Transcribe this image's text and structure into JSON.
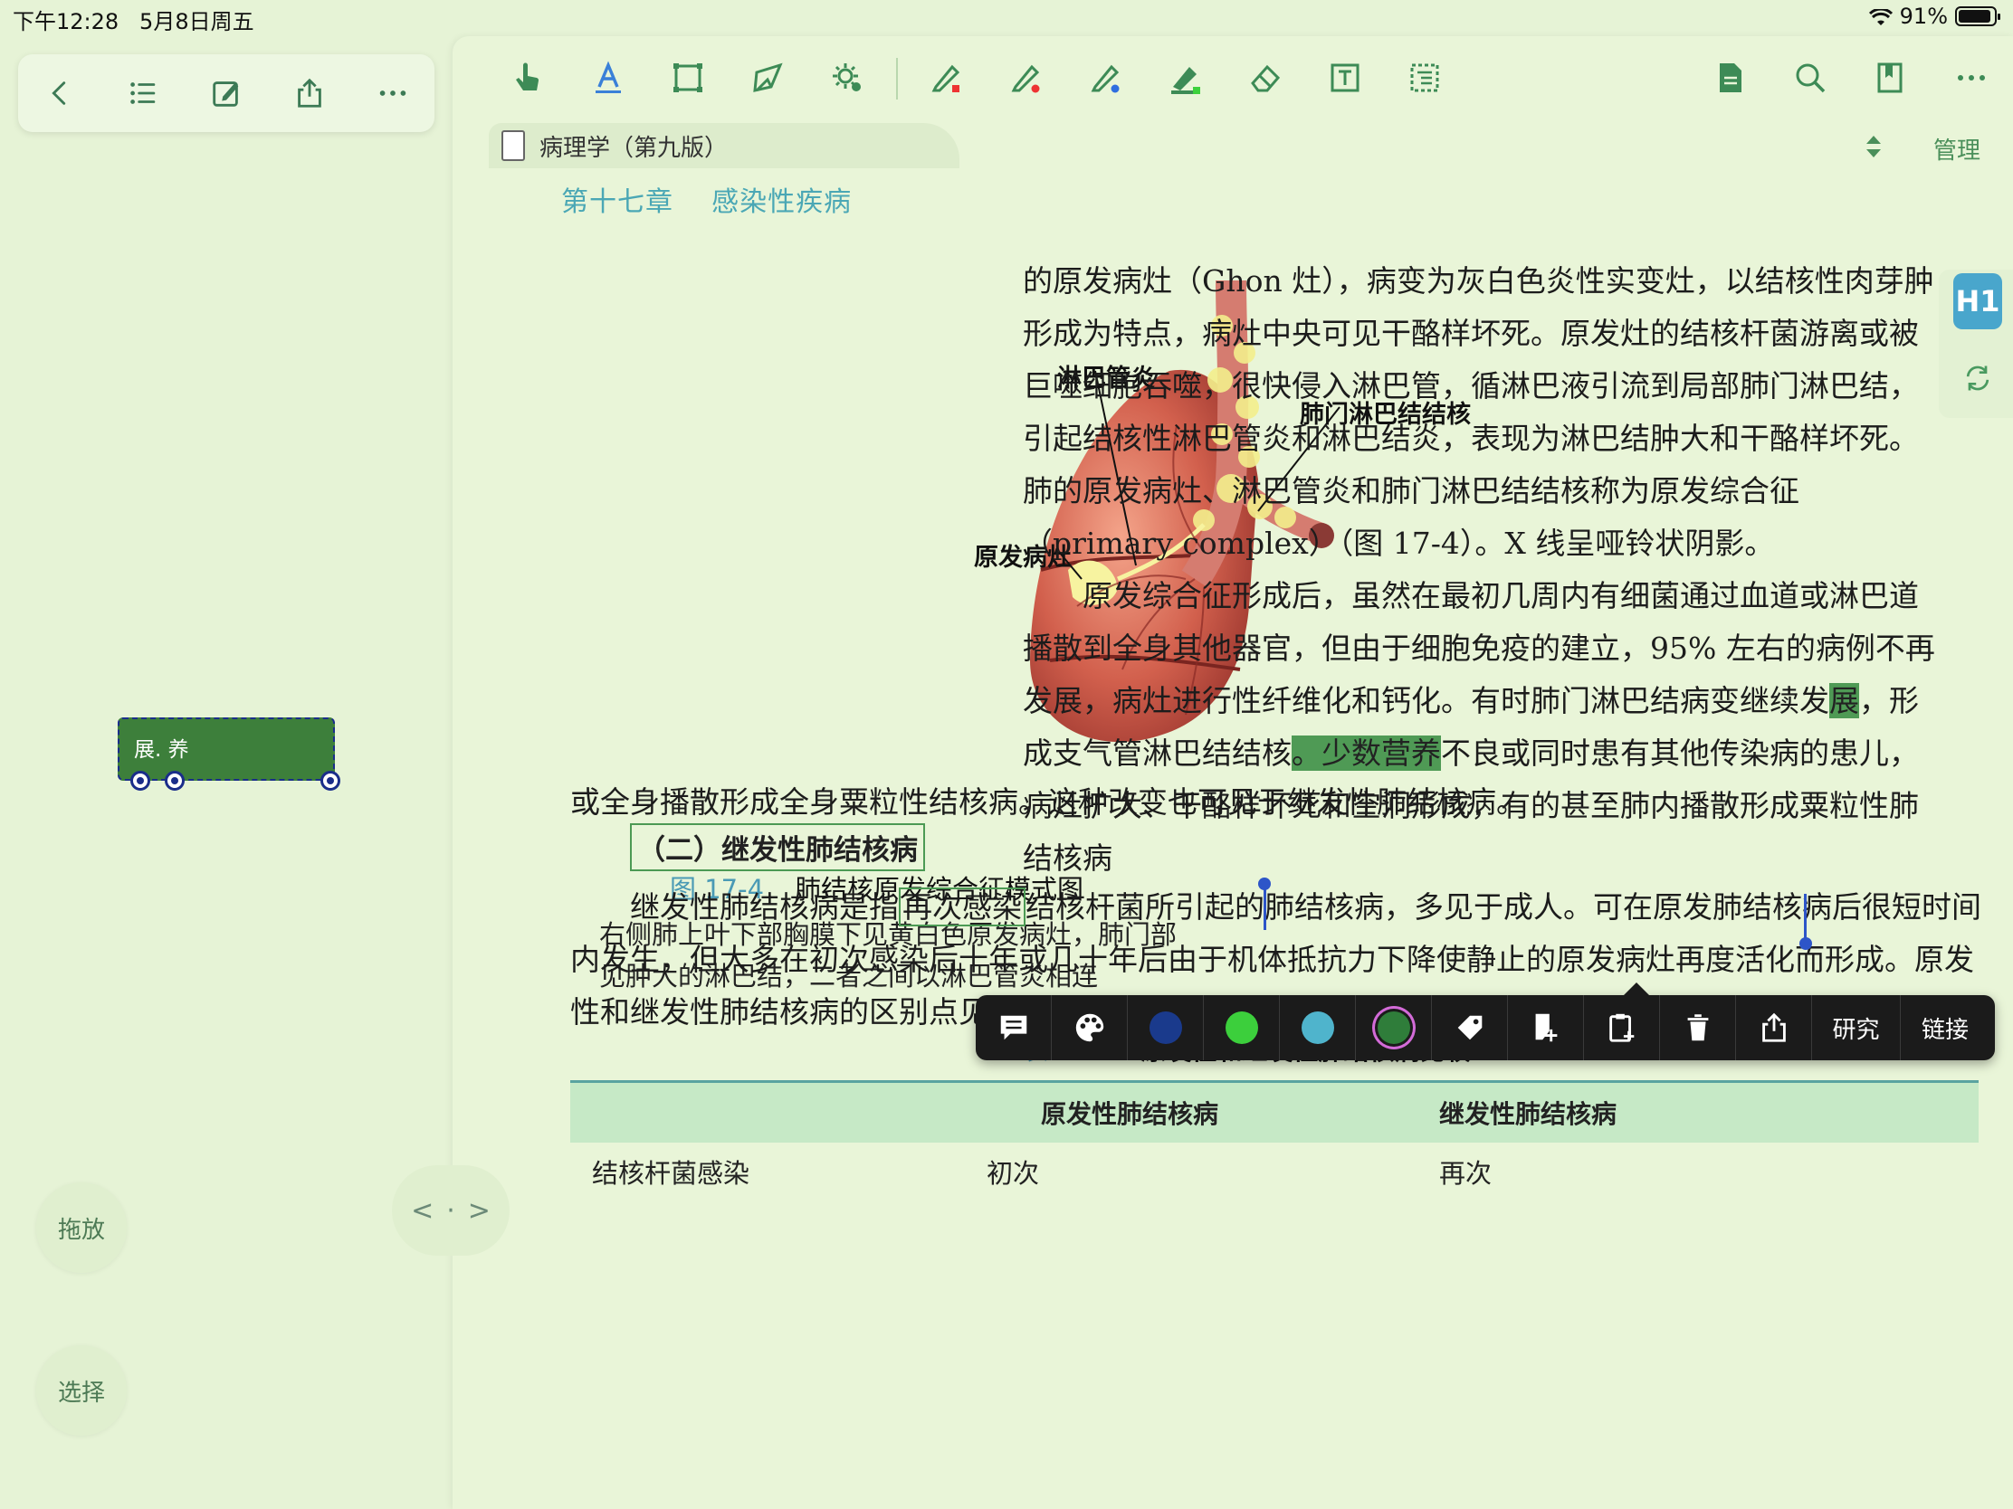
{
  "status": {
    "time": "下午12:28   5月8日周五",
    "battery": "91%",
    "battery_level": 0.91
  },
  "left_toolbar": {
    "icons": [
      "back-chevron-icon",
      "list-icon",
      "edit-icon",
      "share-icon",
      "more-icon"
    ]
  },
  "side_buttons": {
    "drag": "拖放",
    "select": "选择"
  },
  "note": {
    "text": "展. 养"
  },
  "center_nav": {
    "left": "<",
    "dot": "·",
    "right": ">"
  },
  "main_toolbar": {
    "icons": [
      "hand-icon",
      "text-select-icon",
      "rect-select-icon",
      "lasso-icon",
      "settings-gear-icon",
      "pen-red-icon",
      "pen-red-dot-icon",
      "pen-blue-icon",
      "highlighter-green-icon",
      "eraser-icon",
      "textbox-icon",
      "outline-icon",
      "document-icon",
      "search-icon",
      "bookmark-icon",
      "more-icon"
    ]
  },
  "tab": {
    "title": "病理学（第九版）",
    "manage": "管理"
  },
  "chapter": "第十七章    感染性疾病",
  "figure": {
    "labels": {
      "lymphangitis": "淋巴管炎",
      "hilar": "肺门淋巴结结核",
      "primary": "原发病灶"
    },
    "caption_num": "图 17-4",
    "caption_title": "肺结核原发综合征模式图",
    "caption_body": "右侧肺上叶下部胸膜下见黄白色原发病灶，肺门部见肿大的淋巴结，二者之间以淋巴管炎相连"
  },
  "right_text": {
    "p1": "的原发病灶（Ghon 灶），病变为灰白色炎性实变灶，以结核性肉芽肿形成为特点，病灶中央可见干酪样坏死。原发灶的结核杆菌游离或被巨噬细胞吞噬，很快侵入淋巴管，循淋巴液引流到局部肺门淋巴结，引起结核性淋巴管炎和淋巴结炎，表现为淋巴结肿大和干酪样坏死。肺的原发病灶、淋巴管炎和肺门淋巴结结核称为原发综合征（primary complex）（图 17-4）。X 线呈哑铃状阴影。",
    "p2a": "原发综合征形成后，虽然在最初几周内有细菌通过血道或淋巴道播散到全身其他器官，但由于细胞免疫的建立，95% 左右的病例不再发展，病灶进行性纤维化和钙化。有时肺门淋巴结病变继续发",
    "p2_hl1": "展",
    "p2b": "，形成支气管淋巴结结核",
    "p2_hl2": "。少数营养",
    "p2c": "不良或同时患有其他传染病的患儿，病灶扩大、干酪样坏死和空洞形成，有的甚至肺内播散形成粟粒性肺结核病"
  },
  "body": {
    "line1": "或全身播散形成全身粟粒性结核病。这种改变也可见于继发性肺结核病。",
    "section": "（二）继发性肺结核病",
    "p_a": "继发性肺结核病是指",
    "p_box": "再次感染",
    "p_b": "结核杆菌所引起的肺结核病，多见于成人。可在原发肺结核病后很短时间内发生，但大多在初次感染后十年或几十年后由于机体抵抗力下降使静止的原发病灶再度活化而形成。原发性和继发性肺结核病的区别点见表 17-2。"
  },
  "table": {
    "num": "表 17-2",
    "title": "原发性和继发性肺结核病比较",
    "headers": [
      "",
      "原发性肺结核病",
      "继发性肺结核病"
    ],
    "rows": [
      [
        "结核杆菌感染",
        "初次",
        "再次"
      ]
    ]
  },
  "context_menu": {
    "icons": [
      "comment-icon",
      "palette-icon",
      "color-navy-swatch",
      "color-green-swatch",
      "color-cyan-swatch",
      "color-darkgreen-swatch",
      "tag-icon",
      "add-note-icon",
      "clipboard-add-icon",
      "trash-icon",
      "share-icon"
    ],
    "colors": [
      "#1a3a8c",
      "#3ccf3c",
      "#4fb4cc",
      "#2f7d3a"
    ],
    "research": "研究",
    "link": "链接"
  },
  "right_edge": {
    "h1": "H1"
  }
}
